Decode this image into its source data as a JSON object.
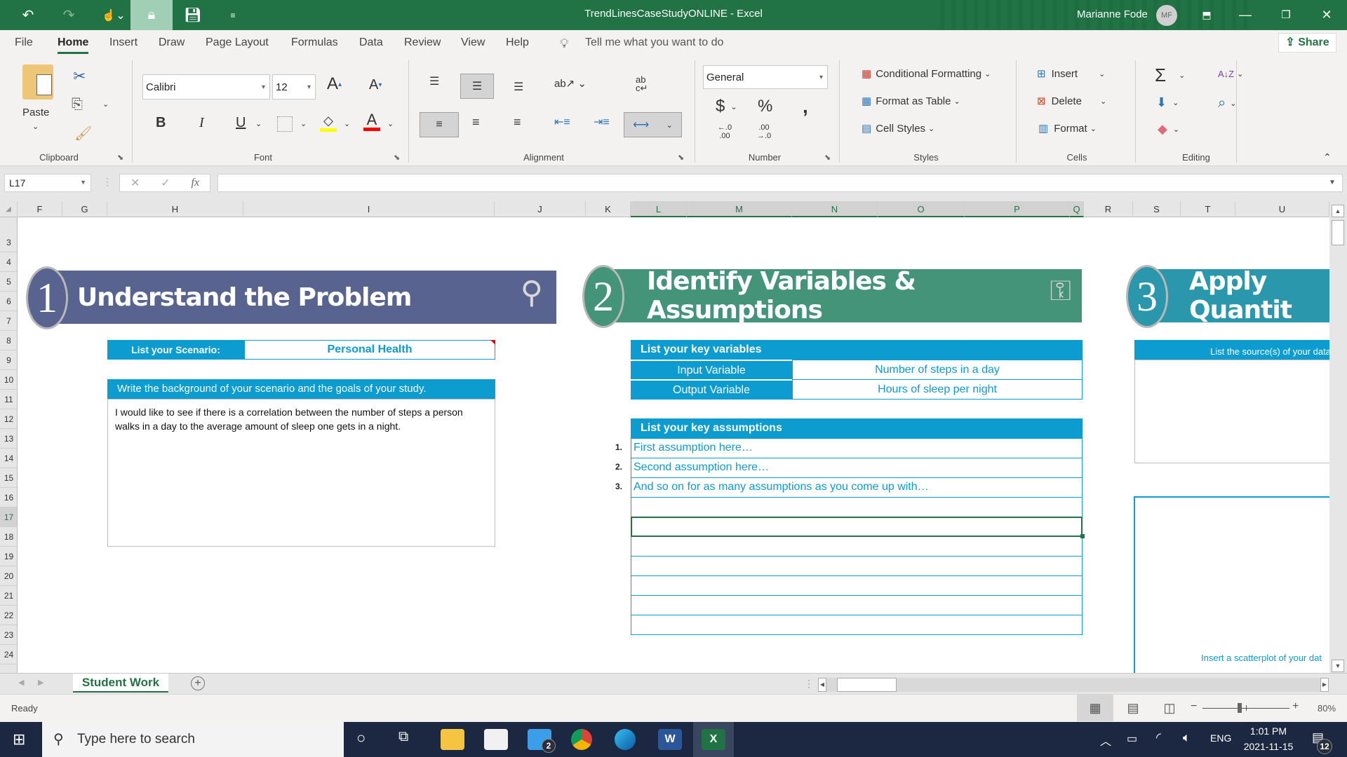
{
  "titlebar": {
    "document_title": "TrendLinesCaseStudyONLINE  -  Excel",
    "user_name": "Marianne Fode",
    "user_initials": "MF",
    "quick_access": [
      "undo-icon",
      "redo-icon",
      "touch-mode-icon",
      "lock-icon",
      "save-icon",
      "customize-qat-icon"
    ]
  },
  "menu": {
    "tabs": [
      "File",
      "Home",
      "Insert",
      "Draw",
      "Page Layout",
      "Formulas",
      "Data",
      "Review",
      "View",
      "Help"
    ],
    "active_tab": "Home",
    "tell_me": "Tell me what you want to do",
    "share": "Share"
  },
  "ribbon": {
    "clipboard": {
      "label": "Clipboard",
      "paste": "Paste"
    },
    "font": {
      "label": "Font",
      "font_name": "Calibri",
      "font_size": "12",
      "bold": "B",
      "italic": "I",
      "underline": "U",
      "fill_color": "#ffff00",
      "font_color": "#ff0000"
    },
    "alignment": {
      "label": "Alignment",
      "wrap": "ab c↵"
    },
    "number": {
      "label": "Number",
      "format": "General",
      "currency": "$",
      "percent": "%",
      "comma": ",",
      "inc_decimal": "←.0 .00",
      "dec_decimal": ".00 →.0"
    },
    "styles": {
      "label": "Styles",
      "conditional": "Conditional Formatting",
      "format_table": "Format as Table",
      "cell_styles": "Cell Styles"
    },
    "cells": {
      "label": "Cells",
      "insert": "Insert",
      "delete": "Delete",
      "format": "Format"
    },
    "editing": {
      "label": "Editing",
      "sum": "Σ",
      "sort": "A↓Z",
      "find": "⌕"
    }
  },
  "formula_bar": {
    "name_box": "L17",
    "cancel": "✕",
    "enter": "✓",
    "fx": "fx",
    "formula": ""
  },
  "columns": [
    "F",
    "G",
    "H",
    "I",
    "J",
    "K",
    "L",
    "M",
    "N",
    "O",
    "P",
    "Q",
    "R",
    "S",
    "T",
    "U"
  ],
  "selected_columns": [
    "L",
    "M",
    "N",
    "O",
    "P",
    "Q"
  ],
  "rows": [
    "3",
    "4",
    "5",
    "6",
    "7",
    "8",
    "9",
    "10",
    "11",
    "12",
    "13",
    "14",
    "15",
    "16",
    "17",
    "18",
    "19",
    "20",
    "21",
    "22",
    "23",
    "24"
  ],
  "selected_row": "17",
  "section1": {
    "number": "1",
    "title": "Understand the Problem",
    "color": "#58638f",
    "scenario_label": "List your Scenario:",
    "scenario_value": "Personal Health",
    "background_header": "Write the background of your scenario and the goals of your study.",
    "background_text": "I would like to see if there is a correlation between the number of steps a person walks in a day to the average amount of sleep one gets in a night."
  },
  "section2": {
    "number": "2",
    "title": "Identify Variables & Assumptions",
    "color": "#449479",
    "variables_header": "List your key variables",
    "variables": [
      {
        "label": "Input Variable",
        "value": "Number of steps in a day"
      },
      {
        "label": "Output Variable",
        "value": "Hours of sleep per night"
      }
    ],
    "assumptions_header": "List your key assumptions",
    "assumptions": [
      {
        "num": "1.",
        "text": "First assumption here…"
      },
      {
        "num": "2.",
        "text": "Second assumption here…"
      },
      {
        "num": "3.",
        "text": "And so on for as many assumptions as you come up with…"
      },
      {
        "num": "",
        "text": ""
      },
      {
        "num": "",
        "text": ""
      },
      {
        "num": "",
        "text": ""
      },
      {
        "num": "",
        "text": ""
      },
      {
        "num": "",
        "text": ""
      },
      {
        "num": "",
        "text": ""
      },
      {
        "num": "",
        "text": ""
      }
    ]
  },
  "section3": {
    "number": "3",
    "title": "Apply Quantit",
    "color": "#2b97ad",
    "sources_header": "List the source(s) of your data",
    "scatter_hint": "Insert a scatterplot of your dat"
  },
  "accent_blue": "#0d9ccf",
  "sheet": {
    "tab": "Student Work",
    "add": "+"
  },
  "status": {
    "text": "Ready",
    "zoom": "80%",
    "zoom_minus": "−",
    "zoom_plus": "+"
  },
  "taskbar": {
    "search_placeholder": "Type here to search",
    "mail_badge": "2",
    "lang": "ENG",
    "time": "1:01 PM",
    "date": "2021-11-15",
    "notifications": "12"
  }
}
